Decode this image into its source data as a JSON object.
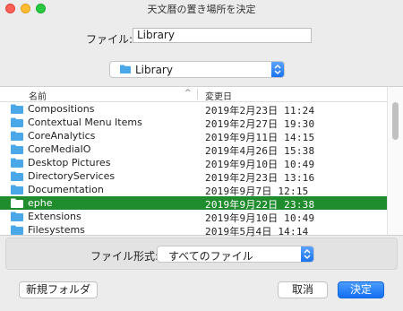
{
  "window": {
    "title": "天文暦の置き場所を決定"
  },
  "filename": {
    "label": "ファイル:",
    "value": "Library"
  },
  "location": {
    "selected": "Library",
    "icon": "folder-icon"
  },
  "list": {
    "columns": {
      "name": "名前",
      "date": "変更日"
    },
    "rows": [
      {
        "name": "Compositions",
        "date": "2019年2月23日 11:24",
        "selected": false
      },
      {
        "name": "Contextual Menu Items",
        "date": "2019年2月27日 19:30",
        "selected": false
      },
      {
        "name": "CoreAnalytics",
        "date": "2019年9月11日 14:15",
        "selected": false
      },
      {
        "name": "CoreMediaIO",
        "date": "2019年4月26日 15:38",
        "selected": false
      },
      {
        "name": "Desktop Pictures",
        "date": "2019年9月10日 10:49",
        "selected": false
      },
      {
        "name": "DirectoryServices",
        "date": "2019年2月23日 13:16",
        "selected": false
      },
      {
        "name": "Documentation",
        "date": "2019年9月7日 12:15",
        "selected": false
      },
      {
        "name": "ephe",
        "date": "2019年9月22日 23:38",
        "selected": true
      },
      {
        "name": "Extensions",
        "date": "2019年9月10日 10:49",
        "selected": false
      },
      {
        "name": "Filesystems",
        "date": "2019年5月4日 14:14",
        "selected": false
      }
    ]
  },
  "filetype": {
    "label": "ファイル形式:",
    "selected": "すべてのファイル"
  },
  "buttons": {
    "new_folder": "新規フォルダ",
    "cancel": "取消",
    "ok": "決定"
  },
  "colors": {
    "selection": "#1f8c2e",
    "folder": "#4aa8e8",
    "accent": "#1a73f0"
  }
}
